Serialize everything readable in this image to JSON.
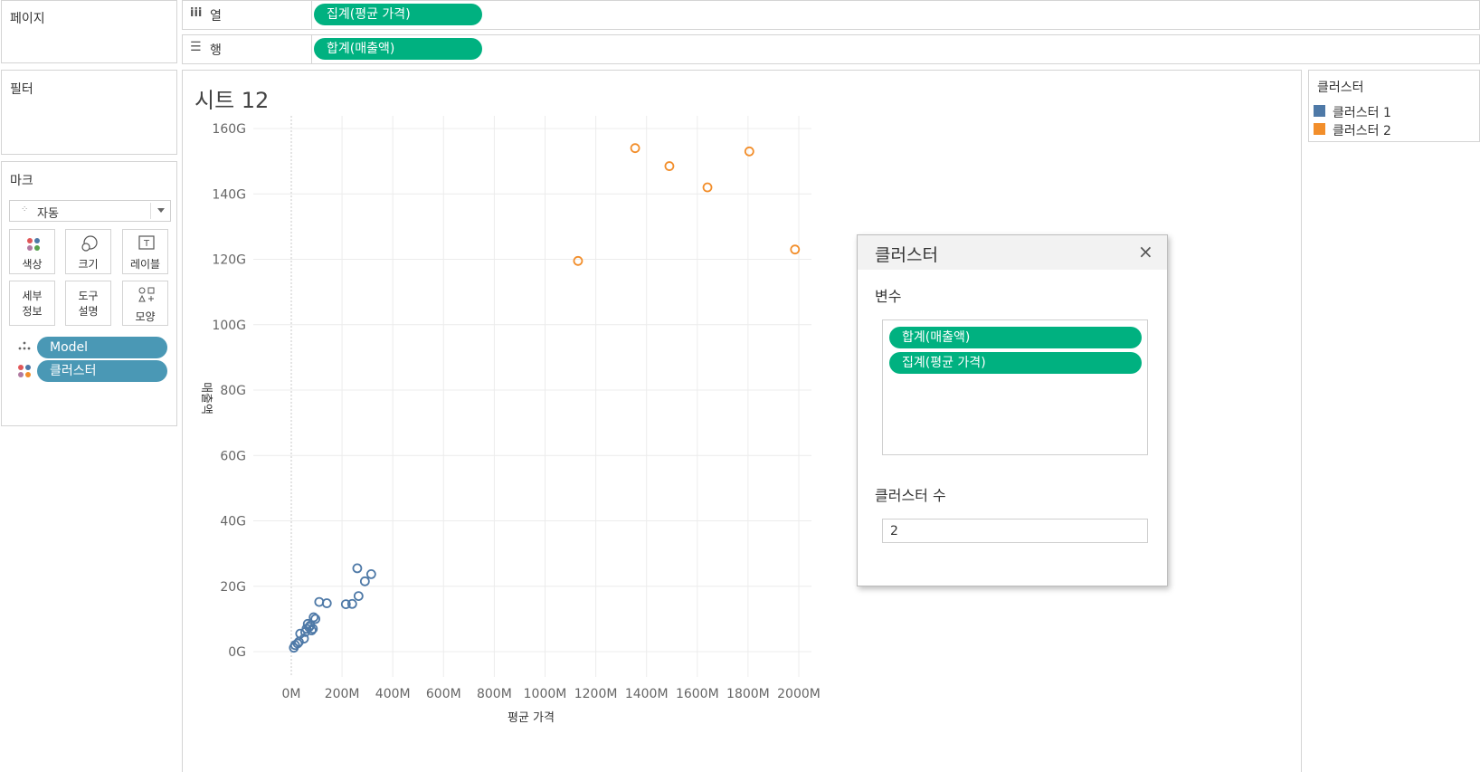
{
  "shelves": {
    "pages_label": "페이지",
    "columns_label": "열",
    "rows_label": "행",
    "columns_pill": "집계(평균 가격)",
    "rows_pill": "합계(매출액)"
  },
  "filters": {
    "title": "필터"
  },
  "marks": {
    "title": "마크",
    "type_select": "자동",
    "buttons": {
      "color": "색상",
      "size": "크기",
      "label": "레이블",
      "detail_1": "세부",
      "detail_2": "정보",
      "tooltip_1": "도구",
      "tooltip_2": "설명",
      "shape": "모양"
    },
    "fields": [
      "Model",
      "클러스터"
    ]
  },
  "sheet": {
    "title": "시트 12"
  },
  "legend": {
    "title": "클러스터",
    "items": [
      {
        "label": "클러스터 1",
        "color": "#4e79a7"
      },
      {
        "label": "클러스터 2",
        "color": "#f28e2b"
      }
    ]
  },
  "cluster_dialog": {
    "title": "클러스터",
    "variables_label": "변수",
    "variables": [
      "합계(매출액)",
      "집계(평균 가격)"
    ],
    "count_label": "클러스터 수",
    "count_value": "2"
  },
  "chart_data": {
    "type": "scatter",
    "title": "",
    "xlabel": "평균 가격",
    "ylabel": "매출액",
    "xlim": [
      -100,
      2100
    ],
    "ylim": [
      -8,
      163
    ],
    "x_ticks": [
      "0M",
      "200M",
      "400M",
      "600M",
      "800M",
      "1000M",
      "1200M",
      "1400M",
      "1600M",
      "1800M",
      "2000M"
    ],
    "y_ticks": [
      "0G",
      "20G",
      "40G",
      "60G",
      "80G",
      "100G",
      "120G",
      "140G",
      "160G"
    ],
    "grid": true,
    "series": [
      {
        "name": "클러스터 1",
        "color": "#4e79a7",
        "points": [
          {
            "x": 10,
            "y": 1.2
          },
          {
            "x": 15,
            "y": 2.0
          },
          {
            "x": 25,
            "y": 2.5
          },
          {
            "x": 30,
            "y": 3.0
          },
          {
            "x": 35,
            "y": 5.5
          },
          {
            "x": 50,
            "y": 4.0
          },
          {
            "x": 55,
            "y": 6.0
          },
          {
            "x": 60,
            "y": 7.0
          },
          {
            "x": 65,
            "y": 8.5
          },
          {
            "x": 70,
            "y": 7.5
          },
          {
            "x": 75,
            "y": 8.0
          },
          {
            "x": 80,
            "y": 6.5
          },
          {
            "x": 85,
            "y": 7.0
          },
          {
            "x": 88,
            "y": 10.5
          },
          {
            "x": 95,
            "y": 10.0
          },
          {
            "x": 110,
            "y": 15.2
          },
          {
            "x": 140,
            "y": 14.8
          },
          {
            "x": 215,
            "y": 14.5
          },
          {
            "x": 240,
            "y": 14.6
          },
          {
            "x": 260,
            "y": 25.5
          },
          {
            "x": 265,
            "y": 17.0
          },
          {
            "x": 290,
            "y": 21.5
          },
          {
            "x": 315,
            "y": 23.7
          }
        ]
      },
      {
        "name": "클러스터 2",
        "color": "#f28e2b",
        "points": [
          {
            "x": 1130,
            "y": 119.5
          },
          {
            "x": 1355,
            "y": 154.0
          },
          {
            "x": 1490,
            "y": 148.5
          },
          {
            "x": 1640,
            "y": 142.0
          },
          {
            "x": 1805,
            "y": 153.0
          },
          {
            "x": 1985,
            "y": 123.0
          }
        ]
      }
    ]
  }
}
